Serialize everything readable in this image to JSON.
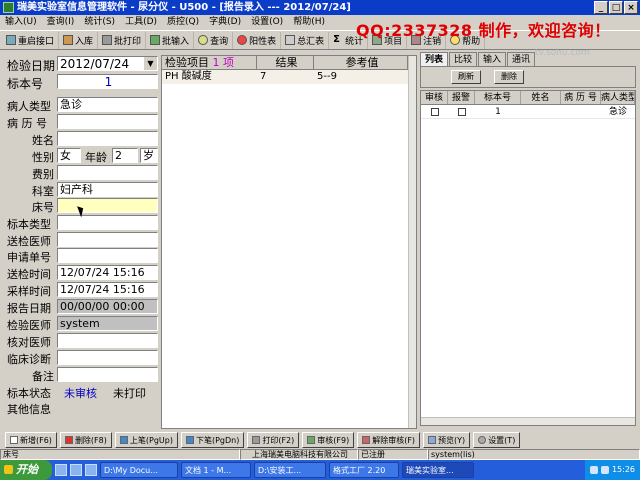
{
  "window": {
    "title": "瑞美实验室信息管理软件 - 尿分仪 - U500 - [报告录入 --- 2012/07/24]",
    "min": "_",
    "max": "□",
    "close": "×"
  },
  "menu": [
    "输入(U)",
    "查询(I)",
    "统计(S)",
    "工具(D)",
    "质控(Q)",
    "字典(D)",
    "设置(O)",
    "帮助(H)"
  ],
  "toolbar": [
    "重启接口",
    "入库",
    "批打印",
    "批输入",
    "查询",
    "阳性表",
    "总汇表",
    "统计",
    "项目",
    "注销",
    "帮助"
  ],
  "watermark": {
    "qq": "QQ:2337328 制作，欢迎咨询！",
    "site": "tv.sohu.com"
  },
  "form": {
    "test_date_label": "检验日期",
    "test_date": "2012/07/24",
    "specimen_no_label": "标本号",
    "specimen_no": "1",
    "patient_type_label": "病人类型",
    "patient_type": "急诊",
    "record_no_label": "病 历 号",
    "record_no": "",
    "name_label": "姓名",
    "name": "",
    "sex_label": "性别",
    "sex": "女",
    "age_label": "年龄",
    "age": "2",
    "age_unit": "岁",
    "fee_label": "费别",
    "fee": "",
    "dept_label": "科室",
    "dept": "妇产科",
    "bed_label": "床号",
    "bed": "",
    "specimen_type_label": "标本类型",
    "specimen_type": "",
    "sender_label": "送检医师",
    "sender": "",
    "request_no_label": "申请单号",
    "request_no": "",
    "send_time_label": "送检时间",
    "send_time": "12/07/24 15:16",
    "sample_time_label": "采样时间",
    "sample_time": "12/07/24 15:16",
    "report_date_label": "报告日期",
    "report_date": "00/00/00 00:00",
    "tester_label": "检验医师",
    "tester": "system",
    "checker_label": "核对医师",
    "checker": "",
    "diagnosis_label": "临床诊断",
    "diagnosis": "",
    "remark_label": "备注",
    "remark": "",
    "status_label": "标本状态",
    "status_review": "未审核",
    "status_print": "未打印",
    "other_label": "其他信息"
  },
  "results": {
    "headers": {
      "item": "检验项目",
      "count": "1 项",
      "result": "结果",
      "ref": "参考值"
    },
    "rows": [
      {
        "item": "PH 酸碱度",
        "result": "7",
        "ref": "5--9"
      }
    ]
  },
  "right": {
    "tabs": [
      "列表",
      "比较",
      "输入",
      "通讯"
    ],
    "refresh": "刷新",
    "delete": "删除",
    "headers": [
      "审核",
      "报警",
      "标本号",
      "姓名",
      "病 历 号",
      "病人类型"
    ],
    "rows": [
      {
        "specimen_no": "1",
        "type": "急诊"
      }
    ]
  },
  "buttons": [
    "新增(F6)",
    "删除(F8)",
    "上笔(PgUp)",
    "下笔(PgDn)",
    "打印(F2)",
    "审核(F9)",
    "解除审核(F)",
    "预览(Y)",
    "设置(T)"
  ],
  "status": {
    "left": "床号",
    "company": "上海瑞美电脑科技有限公司",
    "reg": "已注册",
    "user": "system(lis)"
  },
  "taskbar": {
    "start": "开始",
    "tasks": [
      "D:\\My Docu...",
      "文档 1 - M...",
      "D:\\安装工...",
      "格式工厂 2.20",
      "瑞美实验室..."
    ],
    "clock": "15:26"
  }
}
